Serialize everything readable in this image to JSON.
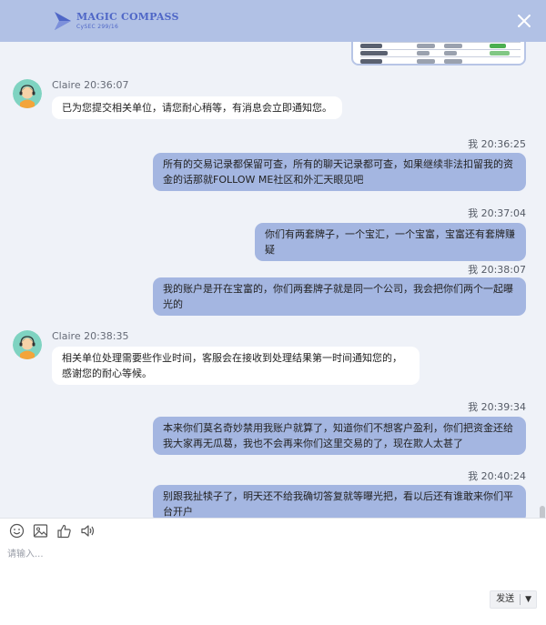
{
  "brand": {
    "name": "MAGIC COMPASS",
    "sub": "CySEC 299/16"
  },
  "messages": [
    {
      "from": "agent",
      "sender": "Claire",
      "time": "20:36:07",
      "text": "已为您提交相关单位，请您耐心稍等，有消息会立即通知您。"
    },
    {
      "from": "me",
      "sender": "我",
      "time": "20:36:25",
      "text": "所有的交易记录都保留可查，所有的聊天记录都可查，如果继续非法扣留我的资金的话那就FOLLOW ME社区和外汇天眼见吧"
    },
    {
      "from": "me",
      "sender": "我",
      "time": "20:37:04",
      "text": "你们有两套牌子，一个宝汇，一个宝富，宝富还有套牌赚疑"
    },
    {
      "from": "me",
      "sender": "我",
      "time": "20:38:07",
      "text": "我的账户是开在宝富的，你们两套牌子就是同一个公司，我会把你们两个一起曝光的"
    },
    {
      "from": "agent",
      "sender": "Claire",
      "time": "20:38:35",
      "text": "相关单位处理需要些作业时间，客服会在接收到处理结果第一时间通知您的，感谢您的耐心等候。"
    },
    {
      "from": "me",
      "sender": "我",
      "time": "20:39:34",
      "text": "本来你们莫名奇妙禁用我账户就算了，知道你们不想客户盈利，你们把资金还给我大家再无瓜葛，我也不会再来你们这里交易的了，现在欺人太甚了"
    },
    {
      "from": "me",
      "sender": "我",
      "time": "20:40:24",
      "text": "别跟我扯犊子了，明天还不给我确切答复就等曝光把，看以后还有谁敢来你们平台开户"
    }
  ],
  "composer": {
    "placeholder": "请输入...",
    "send_label": "发送",
    "dropdown_label": "▼",
    "tools": [
      "emoji-icon",
      "image-icon",
      "thumbs-up-icon",
      "audio-icon"
    ]
  },
  "colors": {
    "header": "#b1c1e5",
    "my_bubble": "#a4b6e1",
    "agent_bubble": "#ffffff",
    "chat_bg": "#eff2f8",
    "brand": "#4f67c7"
  }
}
